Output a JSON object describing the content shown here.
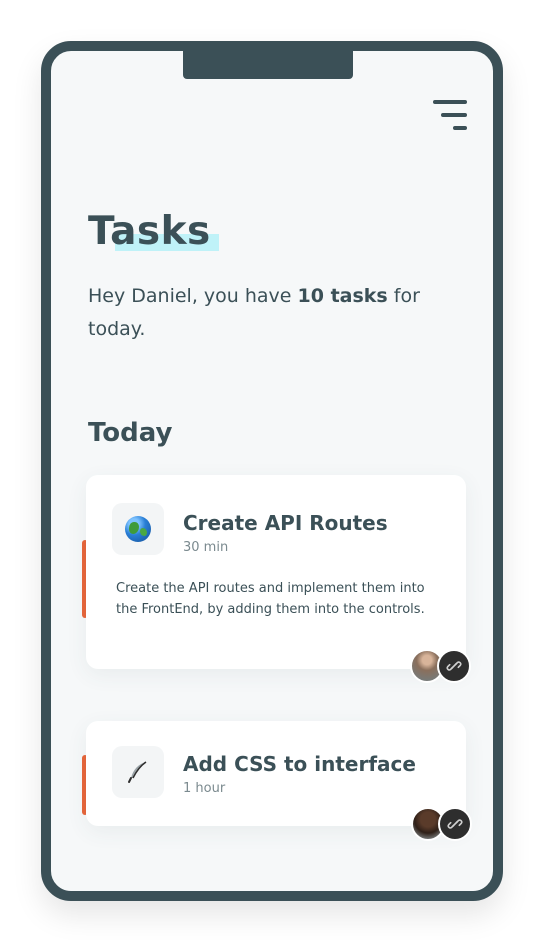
{
  "header": {
    "menu_icon": "menu-icon"
  },
  "page": {
    "title": "Tasks",
    "greeting_prefix": "Hey Daniel, you have ",
    "greeting_count": "10 tasks",
    "greeting_suffix": " for today."
  },
  "section": {
    "title": "Today"
  },
  "tasks": [
    {
      "icon": "globe-icon",
      "title": "Create API Routes",
      "duration": "30 min",
      "description": "Create the API routes and implement them into the FrontEnd, by adding them into the controls.",
      "accent_color": "#e8653a"
    },
    {
      "icon": "quill-pen-icon",
      "title": "Add CSS to interface",
      "duration": "1 hour",
      "accent_color": "#e8653a"
    }
  ],
  "colors": {
    "primary": "#3b5057",
    "accent": "#e8653a",
    "highlight": "#bff2f8",
    "background": "#f6f8f9"
  }
}
